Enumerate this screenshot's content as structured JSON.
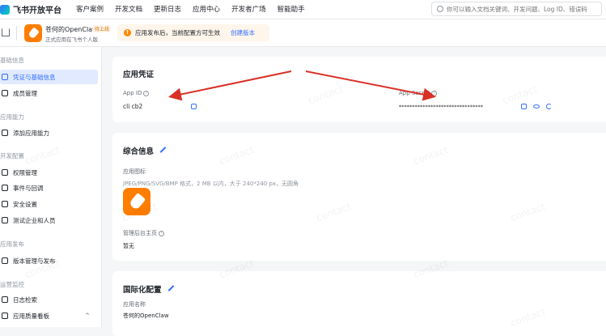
{
  "topbar": {
    "logo_text": "飞书开放平台",
    "nav": [
      "客户案例",
      "开发文档",
      "更新日志",
      "应用中心",
      "开发者广场",
      "智能助手"
    ],
    "search_placeholder": "你可以输入文档关键词、开发问题、Log ID、错误码"
  },
  "appbar": {
    "app_name": "苍何的OpenClaw",
    "badge": "待上线",
    "subtitle": "正式应用在飞书个人版",
    "notice_text": "应用发布后，当前配置方可生效",
    "notice_link": "创建版本"
  },
  "sidebar": {
    "groups": [
      {
        "title": "基础信息",
        "items": [
          {
            "label": "凭证与基础信息",
            "active": true
          },
          {
            "label": "成员管理"
          }
        ]
      },
      {
        "title": "应用能力",
        "items": [
          {
            "label": "添加应用能力"
          }
        ]
      },
      {
        "title": "开发配置",
        "items": [
          {
            "label": "权限管理"
          },
          {
            "label": "事件与回调"
          },
          {
            "label": "安全设置"
          },
          {
            "label": "测试企业和人员"
          }
        ]
      },
      {
        "title": "应用发布",
        "items": [
          {
            "label": "版本管理与发布"
          }
        ]
      },
      {
        "title": "运营监控",
        "items": [
          {
            "label": "日志检索"
          },
          {
            "label": "应用质量看板"
          }
        ]
      }
    ]
  },
  "credentials": {
    "title": "应用凭证",
    "app_id_label": "App ID",
    "app_id_value": "cli        cb2",
    "app_secret_label": "App Secret",
    "app_secret_value": "********************************"
  },
  "general": {
    "title": "综合信息",
    "icon_label": "应用图标",
    "icon_hint": "JPEG/PNG/SVG/BMP 格式，2 MB 以内，大于 240*240 px，无圆角",
    "admin_home_label": "管理后台主页",
    "admin_home_value": "暂无"
  },
  "i18n": {
    "title": "国际化配置",
    "app_name_label": "应用名称",
    "app_name_value": "苍何的OpenClaw"
  },
  "watermark_text": "contact",
  "colors": {
    "accent": "#3370ff",
    "arrow": "#d93026",
    "app_icon": "#ff7d00"
  }
}
